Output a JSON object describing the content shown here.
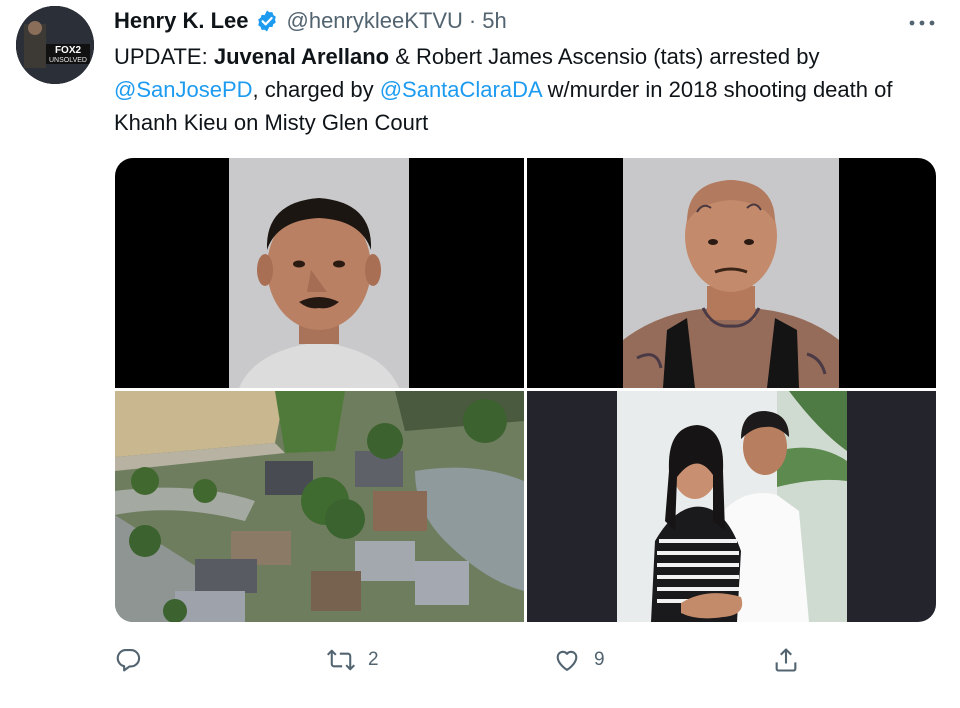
{
  "author": {
    "display_name": "Henry K. Lee",
    "handle": "@henrykleeKTVU",
    "separator": "·",
    "time": "5h",
    "verified": true,
    "avatar_text_top": "FOX2",
    "avatar_text_bottom": "UNSOLVED"
  },
  "tweet": {
    "prefix": "UPDATE: ",
    "name_bold": "Juvenal Arellano",
    "part2": " & Robert James Ascensio (tats) arrested by ",
    "mention1": "@SanJosePD",
    "part3": ", charged by ",
    "mention2": "@SantaClaraDA",
    "part4": " w/murder in 2018 shooting death of Khanh Kieu on Misty Glen Court"
  },
  "media": [
    {
      "kind": "mugshot-photo"
    },
    {
      "kind": "mugshot-tattooed-photo"
    },
    {
      "kind": "aerial-neighborhood-photo"
    },
    {
      "kind": "couple-photo"
    }
  ],
  "actions": {
    "reply_count": "",
    "retweet_count": "2",
    "like_count": "9"
  },
  "colors": {
    "accent": "#1d9bf0",
    "secondary_text": "#536471",
    "primary_text": "#0f1419"
  },
  "icons": [
    "verified-badge-icon",
    "more-icon",
    "reply-icon",
    "retweet-icon",
    "like-icon",
    "share-icon"
  ]
}
